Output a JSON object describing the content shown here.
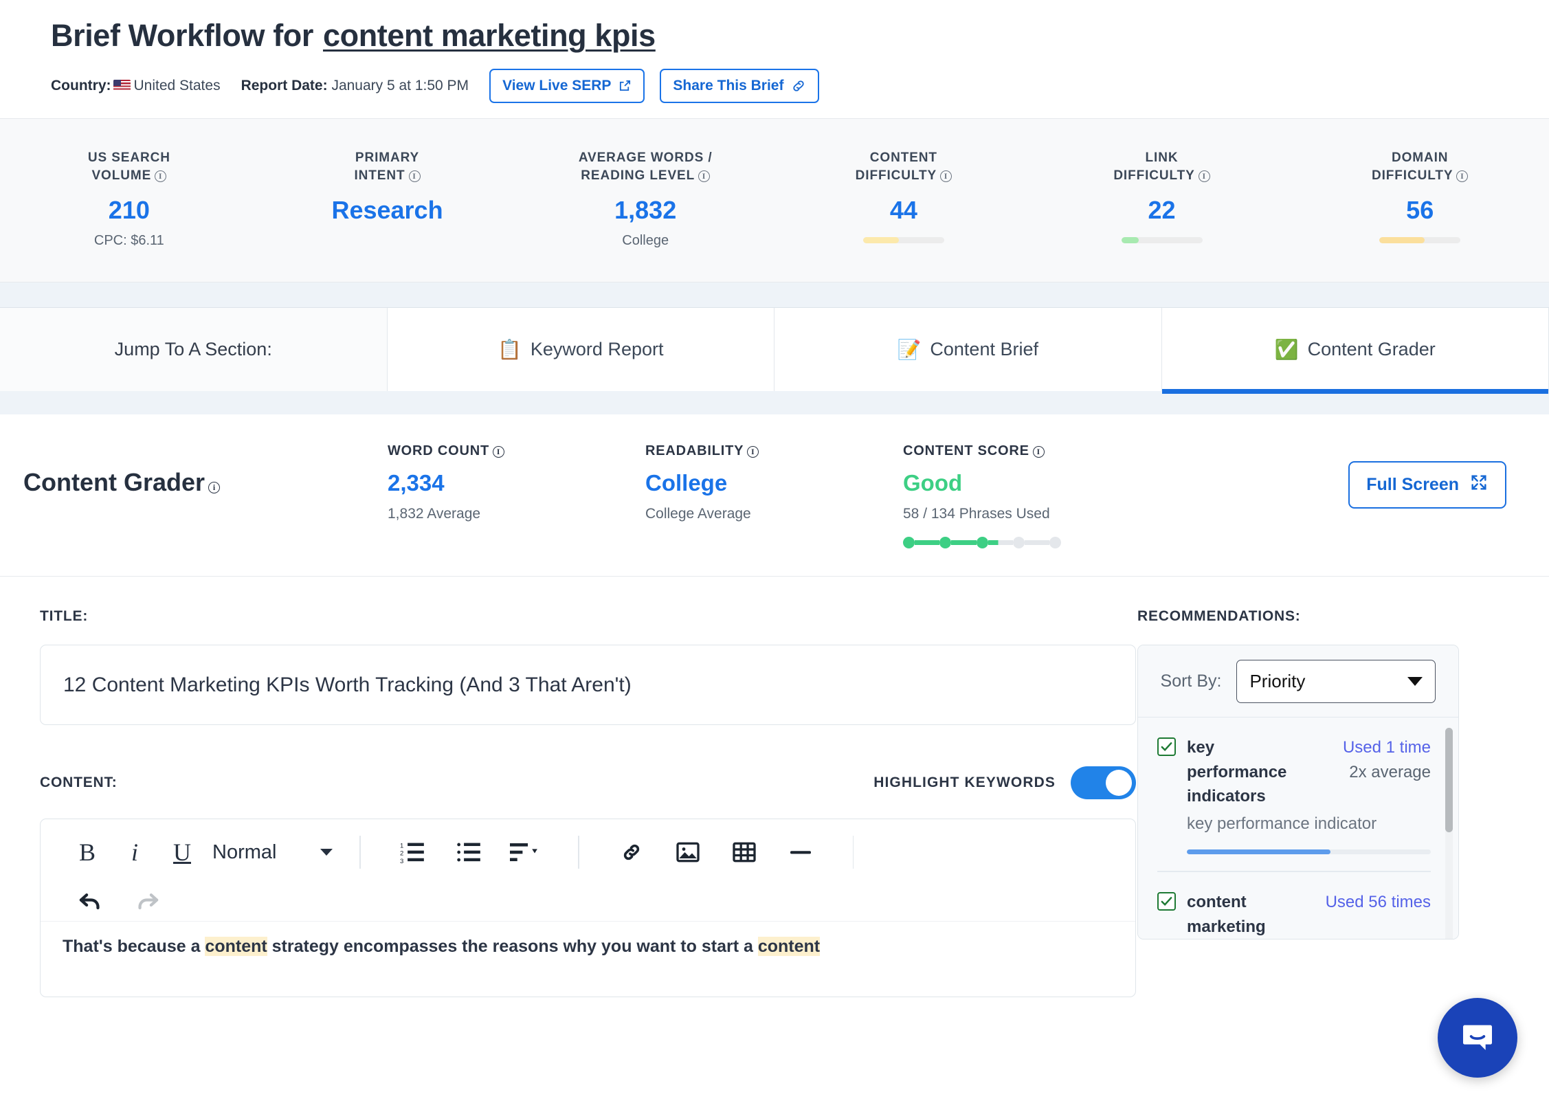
{
  "header": {
    "title_prefix": "Brief Workflow for",
    "keyword": "content marketing kpis",
    "country_label": "Country:",
    "country_value": "United States",
    "report_date_label": "Report Date:",
    "report_date_value": "January 5 at 1:50 PM",
    "view_serp_label": "View Live SERP",
    "share_brief_label": "Share This Brief"
  },
  "metrics": [
    {
      "label_line1": "US SEARCH",
      "label_line2": "VOLUME",
      "value": "210",
      "sub": "CPC: $6.11",
      "bar_pct": null,
      "bar_color": null
    },
    {
      "label_line1": "PRIMARY",
      "label_line2": "INTENT",
      "value": "Research",
      "sub": "",
      "bar_pct": null,
      "bar_color": null
    },
    {
      "label_line1": "AVERAGE WORDS /",
      "label_line2": "READING LEVEL",
      "value": "1,832",
      "sub": "College",
      "bar_pct": null,
      "bar_color": null
    },
    {
      "label_line1": "CONTENT",
      "label_line2": "DIFFICULTY",
      "value": "44",
      "sub": "",
      "bar_pct": 44,
      "bar_color": "#fce9ab"
    },
    {
      "label_line1": "LINK",
      "label_line2": "DIFFICULTY",
      "value": "22",
      "sub": "",
      "bar_pct": 22,
      "bar_color": "#a8eab0"
    },
    {
      "label_line1": "DOMAIN",
      "label_line2": "DIFFICULTY",
      "value": "56",
      "sub": "",
      "bar_pct": 56,
      "bar_color": "#fbdf9c"
    }
  ],
  "tabs": {
    "jump_label": "Jump To A Section:",
    "items": [
      {
        "icon": "📋",
        "label": "Keyword Report",
        "active": false
      },
      {
        "icon": "📝",
        "label": "Content Brief",
        "active": false
      },
      {
        "icon": "✅",
        "label": "Content Grader",
        "active": true
      }
    ]
  },
  "grader": {
    "title": "Content Grader",
    "word_count_label": "WORD COUNT",
    "word_count_value": "2,334",
    "word_count_sub": "1,832 Average",
    "readability_label": "READABILITY",
    "readability_value": "College",
    "readability_sub": "College Average",
    "content_score_label": "CONTENT SCORE",
    "content_score_value": "Good",
    "content_score_sub": "58 / 134 Phrases Used",
    "score_dots_filled": 3,
    "score_dots_total": 5,
    "fullscreen_label": "Full Screen"
  },
  "editor": {
    "title_label": "TITLE:",
    "title_value": "12 Content Marketing KPIs Worth Tracking (And 3 That Aren't)",
    "content_label": "CONTENT:",
    "highlight_label": "HIGHLIGHT KEYWORDS",
    "highlight_on": true,
    "toolbar": {
      "bold": "B",
      "italic": "i",
      "underline": "U",
      "format_value": "Normal"
    },
    "body_text_part1": "That's because a ",
    "body_text_kw1": "content",
    "body_text_part2": " strategy encompasses the reasons why you want to start a ",
    "body_text_kw2": "content"
  },
  "recommendations": {
    "heading": "RECOMMENDATIONS:",
    "sort_label": "Sort By:",
    "sort_value": "Priority",
    "sort_options": [
      "Priority"
    ],
    "items": [
      {
        "name": "key performance indicators",
        "variant": "key performance indicator",
        "used": "Used 1 time",
        "average": "2x average",
        "progress_pct": 59,
        "checked": true
      },
      {
        "name": "content marketing",
        "variant": "",
        "used": "Used 56 times",
        "average": "",
        "progress_pct": 0,
        "checked": true
      }
    ]
  }
}
